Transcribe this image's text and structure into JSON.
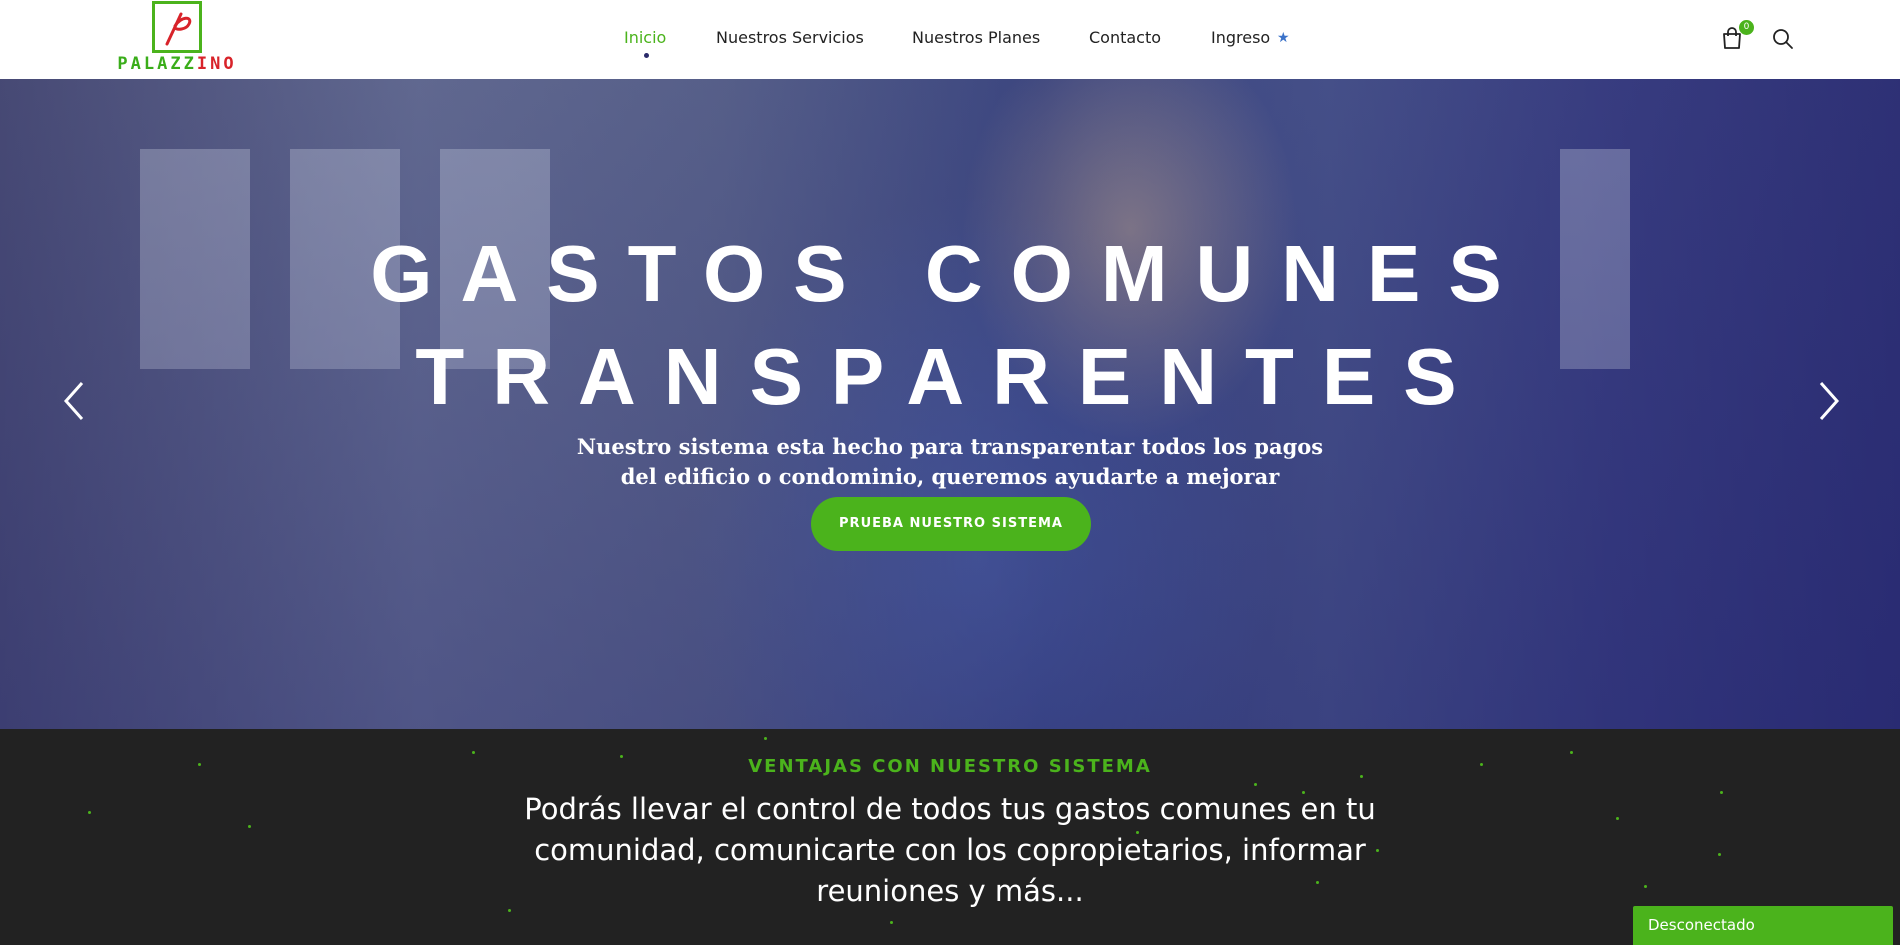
{
  "logo": {
    "text_green": "PALAZZ",
    "text_red": "INO",
    "accent_green": "#4bb31c",
    "accent_red": "#d8232a"
  },
  "nav": {
    "items": [
      {
        "label": "Inicio",
        "active": true
      },
      {
        "label": "Nuestros Servicios"
      },
      {
        "label": "Nuestros Planes"
      },
      {
        "label": "Contacto"
      },
      {
        "label": "Ingreso"
      }
    ],
    "ingreso_icon": "star-icon",
    "cart_icon": "shopping-bag-icon",
    "cart_count": "0",
    "search_icon": "search-icon"
  },
  "hero": {
    "title_line1": "GASTOS COMUNES",
    "title_line2": "TRANSPARENTES",
    "subtitle_line1": "Nuestro sistema esta hecho para transparentar todos los pagos",
    "subtitle_line2": "del edificio o condominio, queremos ayudarte a mejorar",
    "cta_label": "PRUEBA NUESTRO SISTEMA",
    "prev_icon": "chevron-left-icon",
    "next_icon": "chevron-right-icon"
  },
  "section": {
    "kicker": "VENTAJAS CON NUESTRO SISTEMA",
    "text": "Podrás llevar el control de todos tus gastos comunes en tu comunidad, comunicarte con los copropietarios, informar reuniones y más..."
  },
  "status": {
    "label": "Desconectado"
  },
  "colors": {
    "accent": "#4bb31c",
    "dark_section": "#222222",
    "nav_text": "#222222"
  }
}
